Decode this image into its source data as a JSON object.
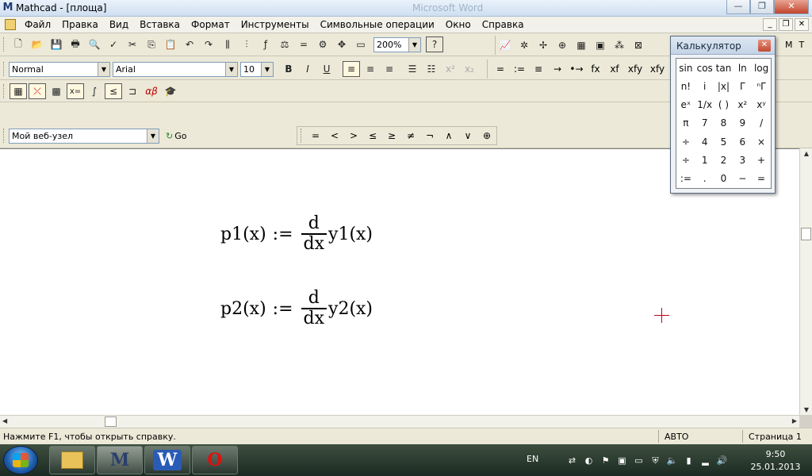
{
  "titlebar": {
    "title": "Mathcad - [площа]",
    "ghost_title": "Microsoft Word",
    "app_icon": "M"
  },
  "menu": {
    "items": [
      "Файл",
      "Правка",
      "Вид",
      "Вставка",
      "Формат",
      "Инструменты",
      "Символьные операции",
      "Окно",
      "Справка"
    ]
  },
  "toolbar_standard": {
    "zoom": "200%",
    "help": "?"
  },
  "toolbar_format": {
    "style": "Normal",
    "font": "Arial",
    "size": "10",
    "bold": "B",
    "italic": "I",
    "underline": "U",
    "ops": [
      "=",
      ":=",
      "≡",
      "→",
      "•→",
      "fx",
      "xf",
      "xfy",
      "xfy"
    ]
  },
  "toolbar_math": {
    "web_site": "Мой веб-узел",
    "go": "Go"
  },
  "toolbar_bool": {
    "ops": [
      "=",
      "<",
      ">",
      "≤",
      "≥",
      "≠",
      "¬",
      "∧",
      "∨",
      "⊕"
    ]
  },
  "right_toolbar": {
    "ops": [
      "M",
      "T"
    ]
  },
  "calculator": {
    "title": "Калькулятор",
    "keys": [
      "sin",
      "cos",
      "tan",
      "ln",
      "log",
      "n!",
      "i",
      "|x|",
      "Γ",
      "ⁿΓ",
      "eˣ",
      "1/x",
      "( )",
      "x²",
      "xʸ",
      "π",
      "7",
      "8",
      "9",
      "/",
      "÷",
      "4",
      "5",
      "6",
      "×",
      "÷",
      "1",
      "2",
      "3",
      "+",
      ":=",
      ".",
      "0",
      "−",
      "="
    ]
  },
  "equations": [
    {
      "lhs": "p1(x)",
      "assign": ":=",
      "num": "d",
      "den": "dx",
      "rhs": "y1(x)"
    },
    {
      "lhs": "p2(x)",
      "assign": ":=",
      "num": "d",
      "den": "dx",
      "rhs": "y2(x)"
    }
  ],
  "status": {
    "help": "Нажмите F1, чтобы открыть справку.",
    "mode": "АВТО",
    "page": "Страница 1"
  },
  "taskbar": {
    "lang": "EN",
    "time": "9:50",
    "date": "25.01.2013"
  }
}
